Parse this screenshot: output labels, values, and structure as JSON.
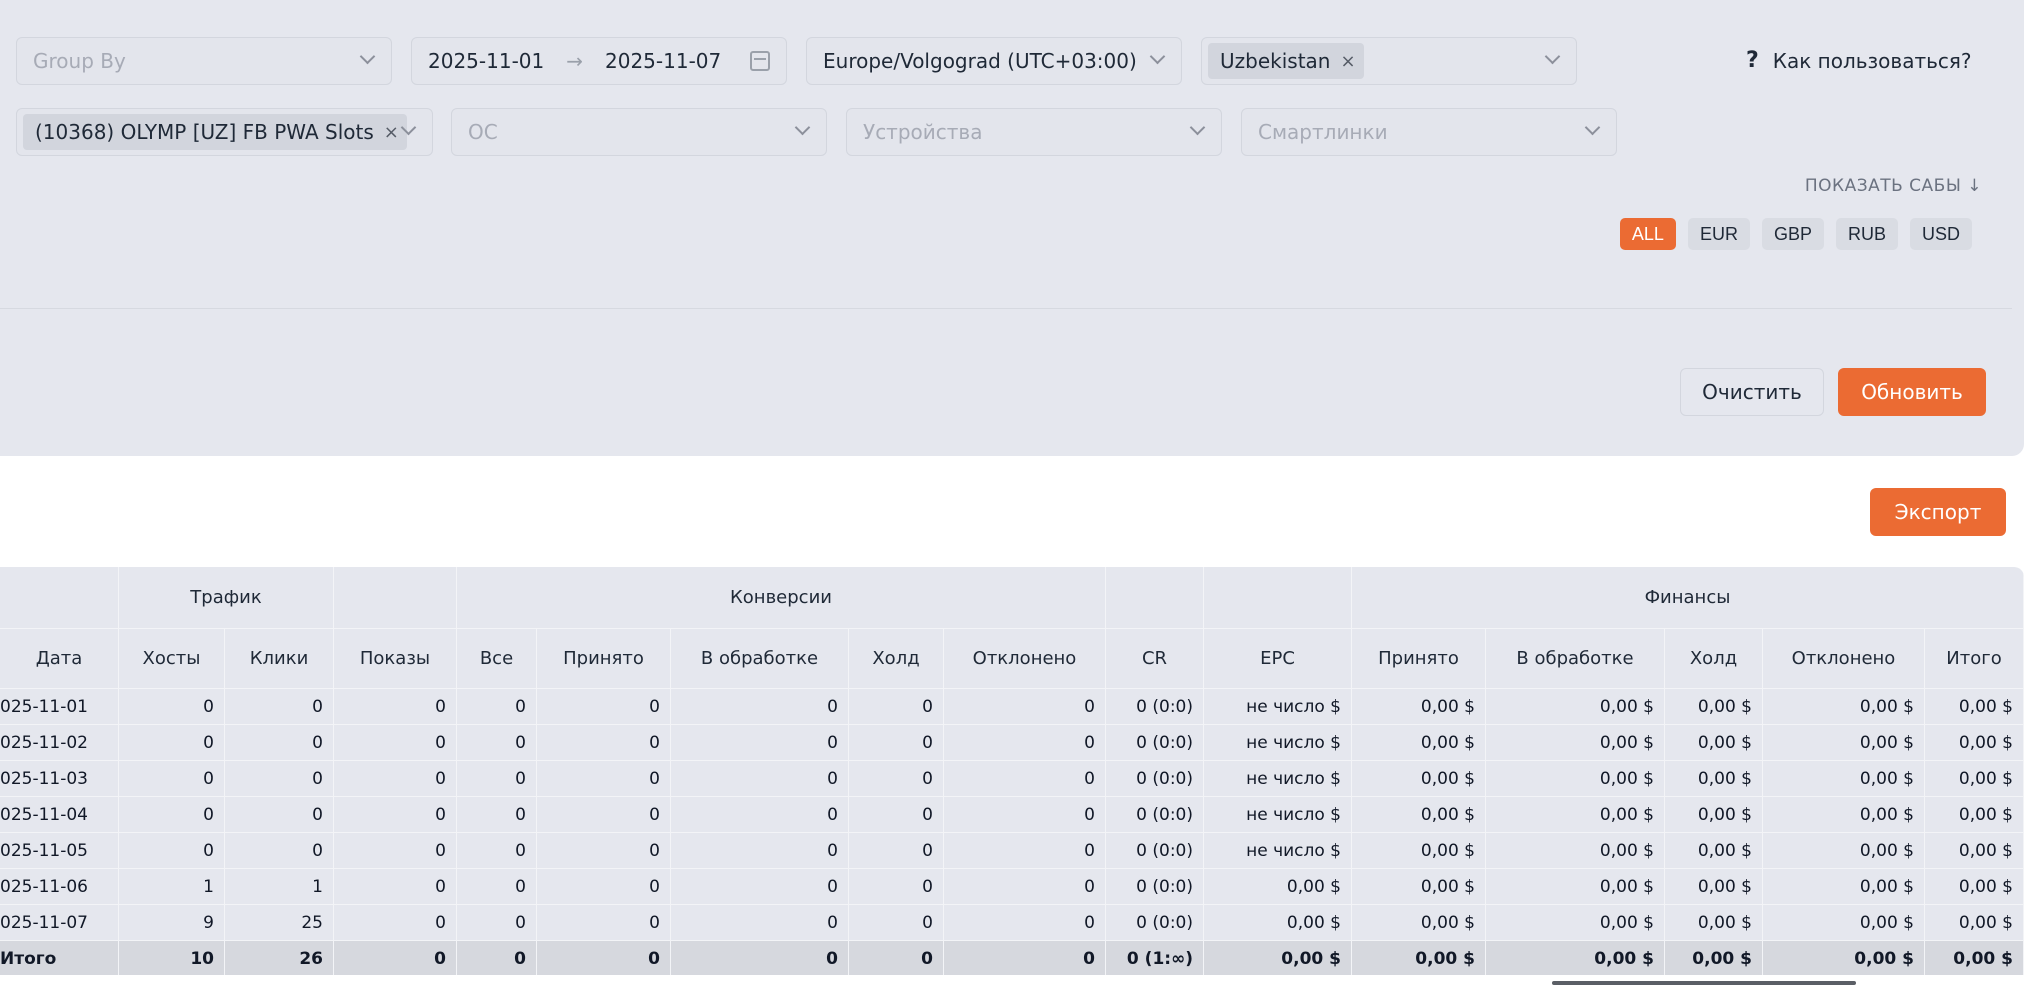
{
  "filters": {
    "group_by_placeholder": "Group By",
    "date_from": "2025-11-01",
    "date_to": "2025-11-07",
    "date_separator": "→",
    "timezone": "Europe/Volgograd (UTC+03:00)",
    "country_tag": "Uzbekistan",
    "offer_tag": "(10368) OLYMP [UZ] FB PWA Slots",
    "os_placeholder": "ОС",
    "devices_placeholder": "Устройства",
    "smartlinks_placeholder": "Смартлинки",
    "tag_remove": "×"
  },
  "help": {
    "icon": "?",
    "label": "Как пользоваться?"
  },
  "show_subs": "ПОКАЗАТЬ САБЫ ↓",
  "currencies": [
    "ALL",
    "EUR",
    "GBP",
    "RUB",
    "USD"
  ],
  "active_currency": "ALL",
  "buttons": {
    "clear": "Очистить",
    "update": "Обновить",
    "export": "Экспорт"
  },
  "colors": {
    "accent": "#eb6b33",
    "panel": "#e5e7ee"
  },
  "table": {
    "groups": {
      "traffic": "Трафик",
      "conversions": "Конверсии",
      "finance": "Финансы"
    },
    "columns": [
      "Дата",
      "Хосты",
      "Клики",
      "Показы",
      "Все",
      "Принято",
      "В обработке",
      "Холд",
      "Отклонено",
      "CR",
      "EPC",
      "Принято",
      "В обработке",
      "Холд",
      "Отклонено",
      "Итого"
    ],
    "rows": [
      [
        "025-11-01",
        "0",
        "0",
        "0",
        "0",
        "0",
        "0",
        "0",
        "0",
        "0 (0:0)",
        "не число $",
        "0,00 $",
        "0,00 $",
        "0,00 $",
        "0,00 $",
        "0,00 $"
      ],
      [
        "025-11-02",
        "0",
        "0",
        "0",
        "0",
        "0",
        "0",
        "0",
        "0",
        "0 (0:0)",
        "не число $",
        "0,00 $",
        "0,00 $",
        "0,00 $",
        "0,00 $",
        "0,00 $"
      ],
      [
        "025-11-03",
        "0",
        "0",
        "0",
        "0",
        "0",
        "0",
        "0",
        "0",
        "0 (0:0)",
        "не число $",
        "0,00 $",
        "0,00 $",
        "0,00 $",
        "0,00 $",
        "0,00 $"
      ],
      [
        "025-11-04",
        "0",
        "0",
        "0",
        "0",
        "0",
        "0",
        "0",
        "0",
        "0 (0:0)",
        "не число $",
        "0,00 $",
        "0,00 $",
        "0,00 $",
        "0,00 $",
        "0,00 $"
      ],
      [
        "025-11-05",
        "0",
        "0",
        "0",
        "0",
        "0",
        "0",
        "0",
        "0",
        "0 (0:0)",
        "не число $",
        "0,00 $",
        "0,00 $",
        "0,00 $",
        "0,00 $",
        "0,00 $"
      ],
      [
        "025-11-06",
        "1",
        "1",
        "0",
        "0",
        "0",
        "0",
        "0",
        "0",
        "0 (0:0)",
        "0,00 $",
        "0,00 $",
        "0,00 $",
        "0,00 $",
        "0,00 $",
        "0,00 $"
      ],
      [
        "025-11-07",
        "9",
        "25",
        "0",
        "0",
        "0",
        "0",
        "0",
        "0",
        "0 (0:0)",
        "0,00 $",
        "0,00 $",
        "0,00 $",
        "0,00 $",
        "0,00 $",
        "0,00 $"
      ]
    ],
    "total": [
      "Итого",
      "10",
      "26",
      "0",
      "0",
      "0",
      "0",
      "0",
      "0",
      "0 (1:∞)",
      "0,00 $",
      "0,00 $",
      "0,00 $",
      "0,00 $",
      "0,00 $",
      "0,00 $"
    ]
  }
}
